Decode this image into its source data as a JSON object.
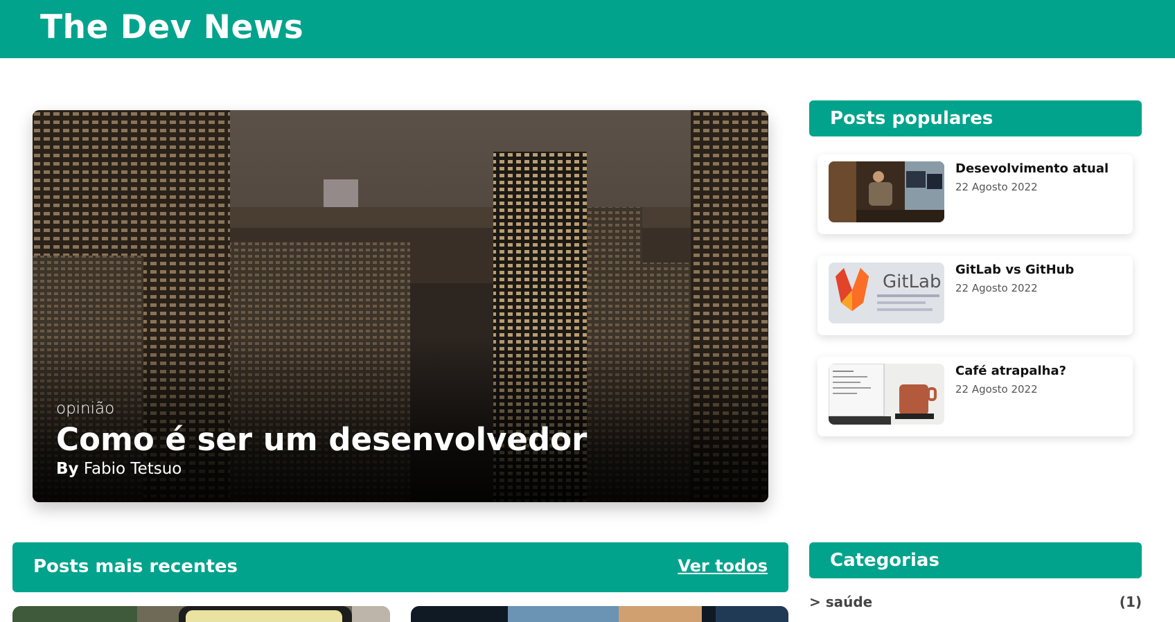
{
  "header": {
    "title": "The Dev News"
  },
  "hero": {
    "category": "opinião",
    "title": "Como é ser um desenvolvedor",
    "author_prefix": "By",
    "author": "Fabio Tetsuo"
  },
  "popular": {
    "heading": "Posts populares",
    "items": [
      {
        "title": "Desevolvimento atual",
        "date": "22 Agosto 2022"
      },
      {
        "title": "GitLab vs GitHub",
        "date": "22 Agosto 2022"
      },
      {
        "title": "Café atrapalha?",
        "date": "22 Agosto 2022"
      }
    ]
  },
  "recent": {
    "heading": "Posts mais recentes",
    "view_all": "Ver todos"
  },
  "categories": {
    "heading": "Categorias",
    "items": [
      {
        "name": "> saúde",
        "count": "(1)"
      }
    ]
  },
  "thumb_text": {
    "gitlab": "GitLab"
  },
  "colors": {
    "accent": "#02a38c"
  }
}
